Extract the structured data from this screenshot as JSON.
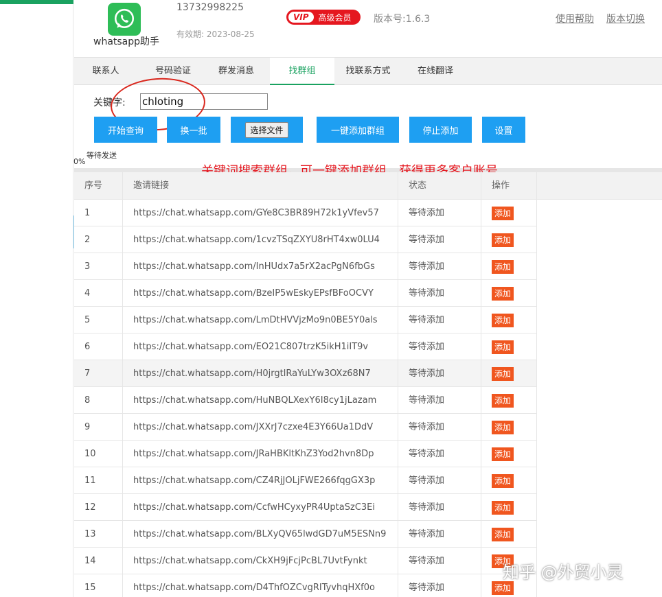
{
  "header": {
    "app_name": "whatsapp助手",
    "phone": "13732998225",
    "expiry": "有效期: 2023-08-25",
    "vip_tag": "VIP",
    "vip_label": "高级会员",
    "version": "版本号:1.6.3",
    "help_link": "使用帮助",
    "switch_link": "版本切换"
  },
  "nav": {
    "tabs": [
      "联系人",
      "号码验证",
      "群发消息",
      "找群组",
      "找联系方式",
      "在线翻译"
    ],
    "active": "找群组"
  },
  "search": {
    "keyword_label": "关键字:",
    "keyword_value": "chloting",
    "buttons": {
      "start": "开始查询",
      "refresh": "换一批",
      "choose_file": "选择文件",
      "add_all": "一键添加群组",
      "stop": "停止添加",
      "settings": "设置"
    }
  },
  "status": {
    "wait_send": "等待发送",
    "progress_percent": "0%"
  },
  "annotation": "关键词搜索群组，可一键添加群组，获得更多客户账号",
  "table": {
    "headers": [
      "序号",
      "邀请链接",
      "状态",
      "操作"
    ],
    "rows": [
      {
        "no": "1",
        "link": "https://chat.whatsapp.com/GYe8C3BR89H72k1yVfev57",
        "status": "等待添加",
        "action": "添加"
      },
      {
        "no": "2",
        "link": "https://chat.whatsapp.com/1cvzTSqZXYU8rHT4xw0LU4",
        "status": "等待添加",
        "action": "添加"
      },
      {
        "no": "3",
        "link": "https://chat.whatsapp.com/InHUdx7a5rX2acPgN6fbGs",
        "status": "等待添加",
        "action": "添加"
      },
      {
        "no": "4",
        "link": "https://chat.whatsapp.com/BzeIP5wEskyEPsfBFoOCVY",
        "status": "等待添加",
        "action": "添加"
      },
      {
        "no": "5",
        "link": "https://chat.whatsapp.com/LmDtHVVjzMo9n0BE5Y0als",
        "status": "等待添加",
        "action": "添加"
      },
      {
        "no": "6",
        "link": "https://chat.whatsapp.com/EO21C807trzK5ikH1iIT9v",
        "status": "等待添加",
        "action": "添加"
      },
      {
        "no": "7",
        "link": "https://chat.whatsapp.com/H0jrgtlRaYuLYw3OXz68N7",
        "status": "等待添加",
        "action": "添加"
      },
      {
        "no": "8",
        "link": "https://chat.whatsapp.com/HuNBQLXexY6I8cy1jLazam",
        "status": "等待添加",
        "action": "添加"
      },
      {
        "no": "9",
        "link": "https://chat.whatsapp.com/JXXrJ7czxe4E3Y66Ua1DdV",
        "status": "等待添加",
        "action": "添加"
      },
      {
        "no": "10",
        "link": "https://chat.whatsapp.com/JRaHBKltKhZ3Yod2hvn8Dp",
        "status": "等待添加",
        "action": "添加"
      },
      {
        "no": "11",
        "link": "https://chat.whatsapp.com/CZ4RjJOLjFWE266fqgGX3p",
        "status": "等待添加",
        "action": "添加"
      },
      {
        "no": "12",
        "link": "https://chat.whatsapp.com/CcfwHCyxyPR4UptaSzC3Ei",
        "status": "等待添加",
        "action": "添加"
      },
      {
        "no": "13",
        "link": "https://chat.whatsapp.com/BLXyQV65lwdGD7uM5ESNn9",
        "status": "等待添加",
        "action": "添加"
      },
      {
        "no": "14",
        "link": "https://chat.whatsapp.com/CkXH9jFcjPcBL7UvtFynkt",
        "status": "等待添加",
        "action": "添加"
      },
      {
        "no": "15",
        "link": "https://chat.whatsapp.com/D4ThfOZCvgRITyvhqHXf0o",
        "status": "等待添加",
        "action": "添加"
      }
    ]
  },
  "watermark": "知乎 @外贸小灵",
  "colors": {
    "brand_green": "#1aa260",
    "button_blue": "#1e9ff2",
    "add_orange": "#f0561f",
    "annotation_red": "#e5171f"
  },
  "icons": {
    "app_logo": "whatsapp-logo-icon",
    "collapse": "chevron-right-icon"
  }
}
